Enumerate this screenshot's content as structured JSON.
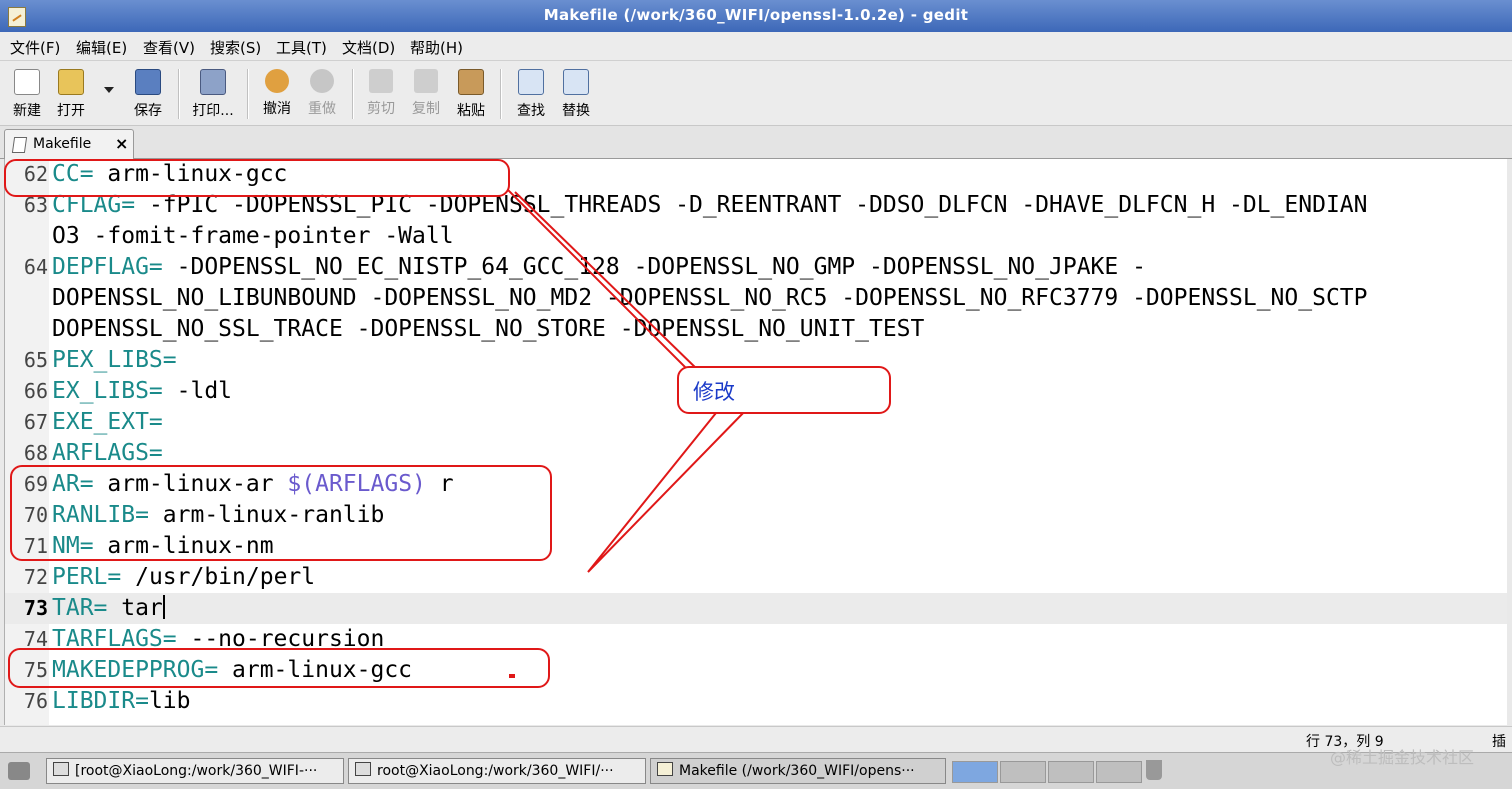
{
  "window": {
    "title": "Makefile (/work/360_WIFI/openssl-1.0.2e) - gedit"
  },
  "menu": [
    {
      "label": "文件(F)"
    },
    {
      "label": "编辑(E)"
    },
    {
      "label": "查看(V)"
    },
    {
      "label": "搜索(S)"
    },
    {
      "label": "工具(T)"
    },
    {
      "label": "文档(D)"
    },
    {
      "label": "帮助(H)"
    }
  ],
  "toolbar": {
    "new": {
      "label": "新建",
      "icon": "new-document-icon"
    },
    "open": {
      "label": "打开",
      "icon": "folder-open-icon"
    },
    "save": {
      "label": "保存",
      "icon": "floppy-save-icon"
    },
    "print": {
      "label": "打印...",
      "icon": "printer-icon"
    },
    "undo": {
      "label": "撤消",
      "icon": "undo-icon"
    },
    "redo": {
      "label": "重做",
      "icon": "redo-icon"
    },
    "cut": {
      "label": "剪切",
      "icon": "scissors-icon"
    },
    "copy": {
      "label": "复制",
      "icon": "copy-icon"
    },
    "paste": {
      "label": "粘贴",
      "icon": "clipboard-paste-icon"
    },
    "find": {
      "label": "查找",
      "icon": "find-icon"
    },
    "replace": {
      "label": "替换",
      "icon": "replace-icon"
    }
  },
  "tab": {
    "label": "Makefile",
    "close": "×"
  },
  "lines": [
    {
      "num": "62",
      "name": "CC=",
      "value": " arm-linux-gcc"
    },
    {
      "num": "63",
      "name": "CFLAG=",
      "value": " -fPIC -DOPENSSL_PIC -DOPENSSL_THREADS -D_REENTRANT -DDSO_DLFCN -DHAVE_DLFCN_H -DL_ENDIAN"
    },
    {
      "num": "",
      "name": "",
      "value": "O3 -fomit-frame-pointer -Wall"
    },
    {
      "num": "64",
      "name": "DEPFLAG=",
      "value": " -DOPENSSL_NO_EC_NISTP_64_GCC_128 -DOPENSSL_NO_GMP -DOPENSSL_NO_JPAKE -"
    },
    {
      "num": "",
      "name": "",
      "value": "DOPENSSL_NO_LIBUNBOUND -DOPENSSL_NO_MD2 -DOPENSSL_NO_RC5 -DOPENSSL_NO_RFC3779 -DOPENSSL_NO_SCTP"
    },
    {
      "num": "",
      "name": "",
      "value": "DOPENSSL_NO_SSL_TRACE -DOPENSSL_NO_STORE -DOPENSSL_NO_UNIT_TEST"
    },
    {
      "num": "65",
      "name": "PEX_LIBS=",
      "value": ""
    },
    {
      "num": "66",
      "name": "EX_LIBS=",
      "value": " -ldl"
    },
    {
      "num": "67",
      "name": "EXE_EXT=",
      "value": ""
    },
    {
      "num": "68",
      "name": "ARFLAGS=",
      "value": ""
    },
    {
      "num": "69",
      "name": "AR=",
      "value": " arm-linux-ar ",
      "macro": "$(ARFLAGS)",
      "tail": " r"
    },
    {
      "num": "70",
      "name": "RANLIB=",
      "value": " arm-linux-ranlib"
    },
    {
      "num": "71",
      "name": "NM=",
      "value": " arm-linux-nm"
    },
    {
      "num": "72",
      "name": "PERL=",
      "value": " /usr/bin/perl"
    },
    {
      "num": "73",
      "name": "TAR=",
      "value": " tar"
    },
    {
      "num": "74",
      "name": "TARFLAGS=",
      "value": " --no-recursion"
    },
    {
      "num": "75",
      "name": "MAKEDEPPROG=",
      "value": " arm-linux-gcc"
    },
    {
      "num": "76",
      "name": "LIBDIR=",
      "value": "lib"
    }
  ],
  "annotation": {
    "label": "修改"
  },
  "status": {
    "position": "行 73，列 9",
    "mode": "插"
  },
  "taskbar": {
    "items": [
      {
        "label": "[root@XiaoLong:/work/360_WIFI-···"
      },
      {
        "label": "root@XiaoLong:/work/360_WIFI/···"
      },
      {
        "label": "Makefile (/work/360_WIFI/opens···"
      }
    ]
  },
  "watermark": "@稀土掘金技术社区",
  "colors": {
    "annotation": "#e01818",
    "variable": "#1a8a8a",
    "macro": "#6a5acd",
    "titlebar": "#4a76c2"
  }
}
